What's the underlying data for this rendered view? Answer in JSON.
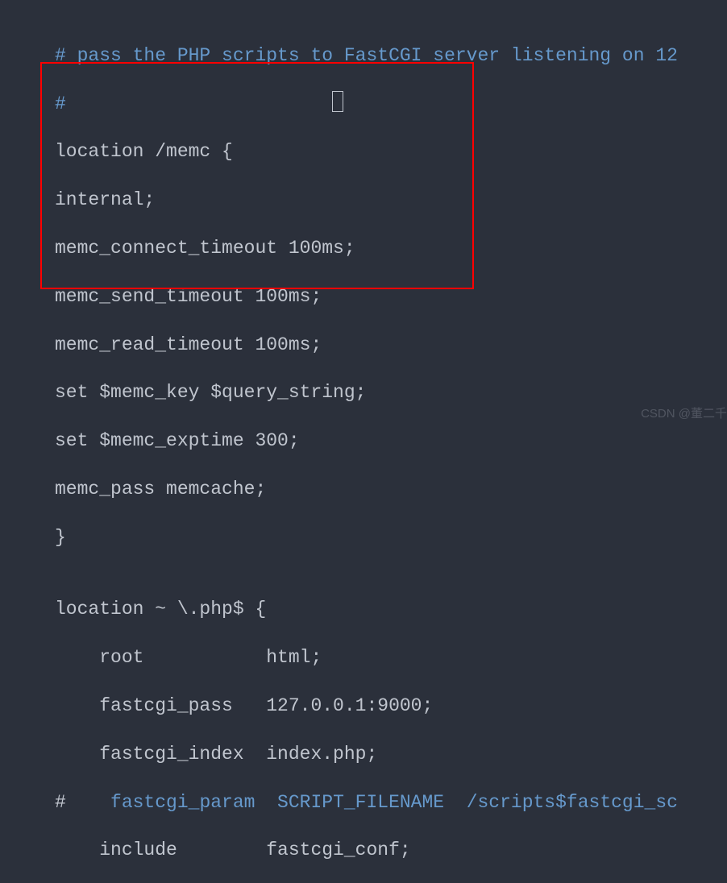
{
  "code": {
    "line1_comment": "# pass the PHP scripts to FastCGI server listening on 12",
    "line2_comment": "#",
    "line3": "location /memc {",
    "line4": "internal;",
    "line5": "memc_connect_timeout 100ms;",
    "line6": "memc_send_timeout 100ms;",
    "line7": "memc_read_timeout 100ms;",
    "line8": "set $memc_key $query_string;",
    "line9": "set $memc_exptime 300;",
    "line10": "memc_pass memcache;",
    "line11": "}",
    "line12": "",
    "line13": "location ~ \\.php$ {",
    "line14": "    root           html;",
    "line15": "    fastcgi_pass   127.0.0.1:9000;",
    "line16": "    fastcgi_index  index.php;",
    "line17_hash": "#",
    "line17_comment": "    fastcgi_param  SCRIPT_FILENAME  /scripts$fastcgi_sc",
    "line18": "    include        fastcgi_conf;"
  },
  "watermark": "CSDN @董二千"
}
